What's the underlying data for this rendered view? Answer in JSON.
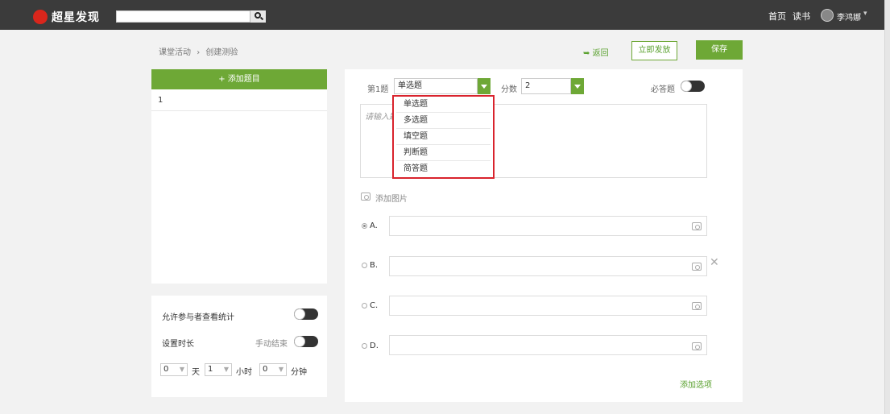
{
  "header": {
    "logo_text": "超星发现",
    "search_placeholder": "",
    "nav": [
      "首页",
      "读书"
    ],
    "user_name": "李鸿娜",
    "user_caret": "▾"
  },
  "breadcrumb": {
    "parent": "课堂活动",
    "sep": "›",
    "current": "创建测验"
  },
  "actions": {
    "back": "返回",
    "publish": "立即发放",
    "save": "保存"
  },
  "left": {
    "add_question": "+ 添加题目",
    "questions": [
      "1"
    ]
  },
  "settings": {
    "allow_stats": "允许参与者查看统计",
    "duration": "设置时长",
    "manual_end": "手动结束",
    "days_value": "0",
    "days_unit": "天",
    "hours_value": "1",
    "hours_unit": "小时",
    "minutes_value": "0",
    "minutes_unit": "分钟"
  },
  "question": {
    "number_label": "第1题",
    "type_value": "单选题",
    "score_label": "分数",
    "score_value": "2",
    "required_label": "必答题",
    "content_placeholder": "请输入题",
    "type_options": [
      "单选题",
      "多选题",
      "填空题",
      "判断题",
      "简答题"
    ],
    "add_image": "添加图片",
    "options": [
      "A.",
      "B.",
      "C.",
      "D."
    ],
    "add_option": "添加选项",
    "delete_symbol": "✕"
  },
  "colors": {
    "topbar": "#3b3b3b",
    "accent": "#6ea836",
    "highlight": "#d9232d"
  }
}
